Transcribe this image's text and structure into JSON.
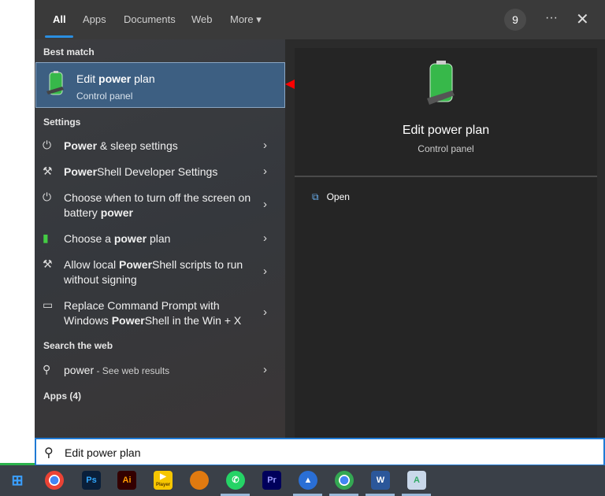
{
  "tabs": [
    {
      "label": "All",
      "active": true
    },
    {
      "label": "Apps"
    },
    {
      "label": "Documents"
    },
    {
      "label": "Web"
    },
    {
      "label": "More ▾"
    }
  ],
  "header": {
    "badge": "9",
    "more_icon": "ellipsis-icon",
    "close_icon": "close-icon"
  },
  "sections": {
    "best_match": "Best match",
    "settings": "Settings",
    "search_web": "Search the web",
    "apps": "Apps (4)"
  },
  "best_match": {
    "pre": "Edit ",
    "bold": "power",
    "post": " plan",
    "subtitle": "Control panel"
  },
  "settings": [
    {
      "icon": "power-icon",
      "pre": "",
      "bold": "Power",
      "post": " & sleep settings"
    },
    {
      "icon": "powershell-dev-icon",
      "pre": "",
      "bold": "Power",
      "post": "Shell Developer Settings"
    },
    {
      "icon": "power-icon",
      "pre": "Choose when to turn off the screen on battery ",
      "bold": "power",
      "post": ""
    },
    {
      "icon": "power-plan-icon",
      "pre": "Choose a ",
      "bold": "power",
      "post": " plan"
    },
    {
      "icon": "powershell-dev-icon",
      "pre": "Allow local ",
      "bold": "Power",
      "post": "Shell scripts to run without signing"
    },
    {
      "icon": "terminal-icon",
      "pre": "Replace Command Prompt with Windows ",
      "bold": "Power",
      "post": "Shell in the Win + X"
    }
  ],
  "web": {
    "query": "power",
    "suffix": " - See web results"
  },
  "preview": {
    "title": "Edit power plan",
    "subtitle": "Control panel",
    "action": "Open"
  },
  "search": {
    "value": "Edit power plan"
  },
  "taskbar": [
    "Chrome",
    "Ps",
    "Ai",
    "Player",
    "Game",
    "WhatsApp",
    "Pr",
    "NordVPN",
    "Chrome",
    "W",
    "Notepad"
  ],
  "colors": {
    "accent": "#2a8ee0",
    "selected": "#3d5f82",
    "arrow": "#ff0000"
  }
}
